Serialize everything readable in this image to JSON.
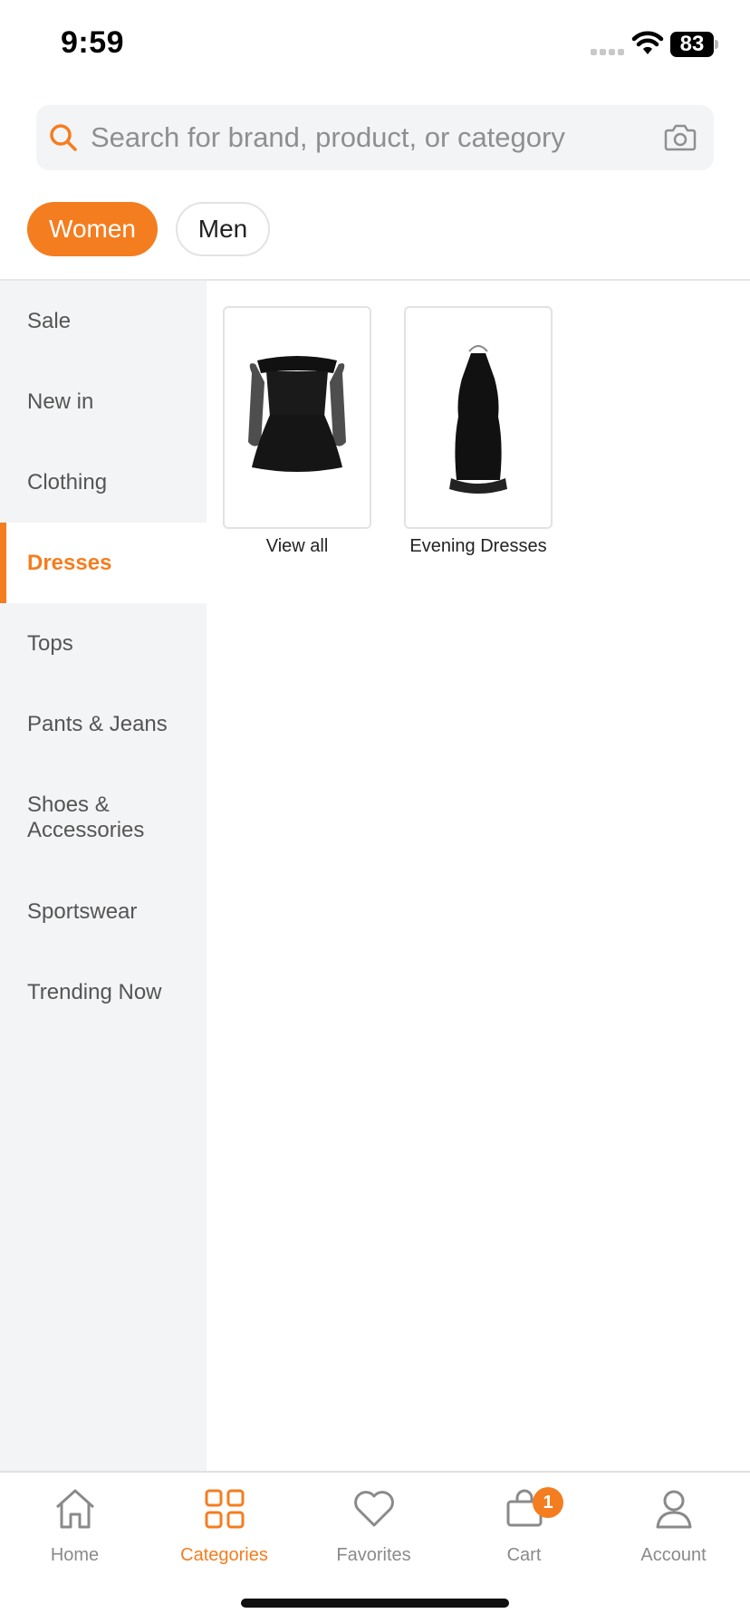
{
  "status_bar": {
    "time": "9:59",
    "battery": "83"
  },
  "search": {
    "placeholder": "Search for brand, product, or category",
    "value": ""
  },
  "gender_tabs": [
    {
      "label": "Women",
      "active": true
    },
    {
      "label": "Men",
      "active": false
    }
  ],
  "sidebar": {
    "items": [
      {
        "label": "Sale"
      },
      {
        "label": "New in"
      },
      {
        "label": "Clothing"
      },
      {
        "label": "Dresses",
        "active": true
      },
      {
        "label": "Tops"
      },
      {
        "label": "Pants & Jeans"
      },
      {
        "label": "Shoes & Accessories"
      },
      {
        "label": "Sportswear"
      },
      {
        "label": "Trending Now"
      }
    ]
  },
  "subcategories": [
    {
      "label": "View all",
      "image": "black-off-shoulder-dress"
    },
    {
      "label": "Evening Dresses",
      "image": "black-halter-dress"
    }
  ],
  "tabbar": {
    "items": [
      {
        "label": "Home",
        "icon": "home-icon"
      },
      {
        "label": "Categories",
        "icon": "grid-icon",
        "active": true
      },
      {
        "label": "Favorites",
        "icon": "heart-icon"
      },
      {
        "label": "Cart",
        "icon": "bag-icon",
        "badge": "1"
      },
      {
        "label": "Account",
        "icon": "person-icon"
      }
    ]
  },
  "colors": {
    "accent": "#f47d1f",
    "sidebar_bg": "#f3f4f6",
    "search_bg": "#f3f4f5"
  }
}
